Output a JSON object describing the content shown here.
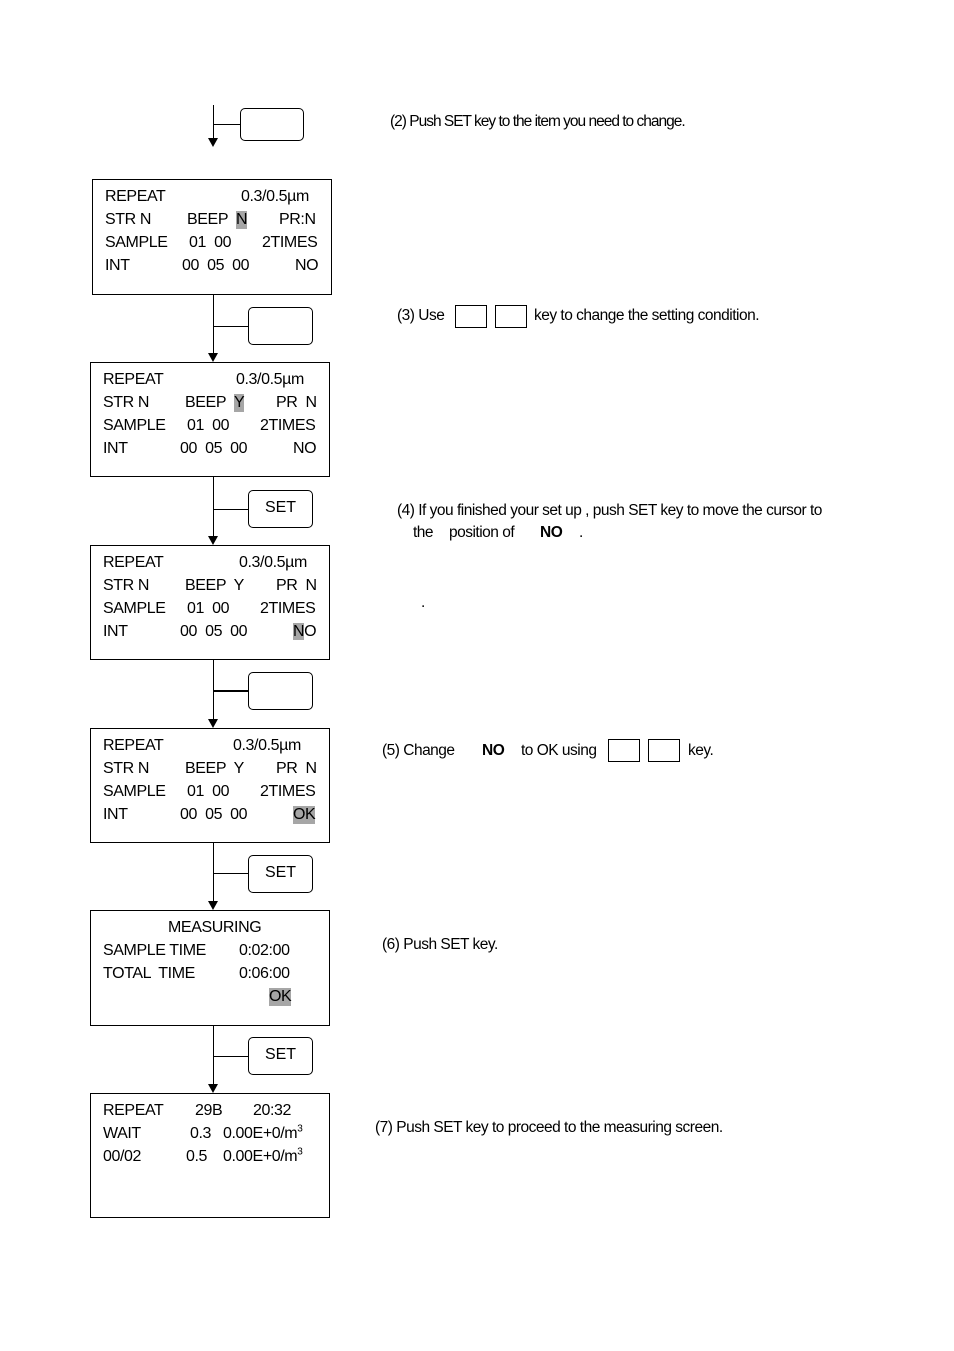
{
  "steps": {
    "s2": "(2) Push SET key to the item you need to change.",
    "s3a": "(3) Use",
    "s3b": "key to change the setting condition.",
    "s4a": "(4) If you finished your set up , push SET key to move the cursor to",
    "s4b": "the",
    "s4c": "position of",
    "s4d": "NO",
    "s4e": ".",
    "s4f": ".",
    "s5a": "(5) Change",
    "s5b": "NO",
    "s5c": "to OK using",
    "s5d": "key.",
    "s6": "(6) Push SET key.",
    "s7": "(7) Push SET key to proceed to the measuring screen."
  },
  "keys": {
    "set": "SET"
  },
  "screens": [
    {
      "r1": [
        "REPEAT",
        "0.3/0.5µm"
      ],
      "r2": [
        "STR N",
        "BEEP",
        "N",
        "PR:N"
      ],
      "r3": [
        "SAMPLE",
        "01  00",
        "2TIMES"
      ],
      "r4": [
        "INT",
        "00  05  00",
        "NO"
      ]
    },
    {
      "r1": [
        "REPEAT",
        "0.3/0.5µm"
      ],
      "r2": [
        "STR N",
        "BEEP",
        "Y",
        "PR  N"
      ],
      "r3": [
        "SAMPLE",
        "01  00",
        "2TIMES"
      ],
      "r4": [
        "INT",
        "00  05  00",
        "NO"
      ]
    },
    {
      "r1": [
        "REPEAT",
        "0.3/0.5µm"
      ],
      "r2": [
        "STR N",
        "BEEP  Y",
        "PR  N"
      ],
      "r3": [
        "SAMPLE",
        "01  00",
        "2TIMES"
      ],
      "r4": [
        "INT",
        "00  05  00",
        "N",
        "O"
      ]
    },
    {
      "r1": [
        "REPEAT",
        "0.3/0.5µm"
      ],
      "r2": [
        "STR N",
        "BEEP  Y",
        "PR  N"
      ],
      "r3": [
        "SAMPLE",
        "01  00",
        "2TIMES"
      ],
      "r4": [
        "INT",
        "00  05  00",
        "OK"
      ]
    },
    {
      "title": "MEASURING",
      "r1": [
        "SAMPLE TIME",
        "0:02:00"
      ],
      "r2": [
        "TOTAL  TIME",
        "0:06:00"
      ],
      "r3": [
        "OK"
      ]
    },
    {
      "r1": [
        "REPEAT",
        "29B",
        "20:32"
      ],
      "r2": [
        "WAIT",
        "0.3",
        "0.00E+0/m",
        "3"
      ],
      "r3": [
        "00/02",
        "0.5",
        "0.00E+0/m",
        "3"
      ]
    }
  ]
}
